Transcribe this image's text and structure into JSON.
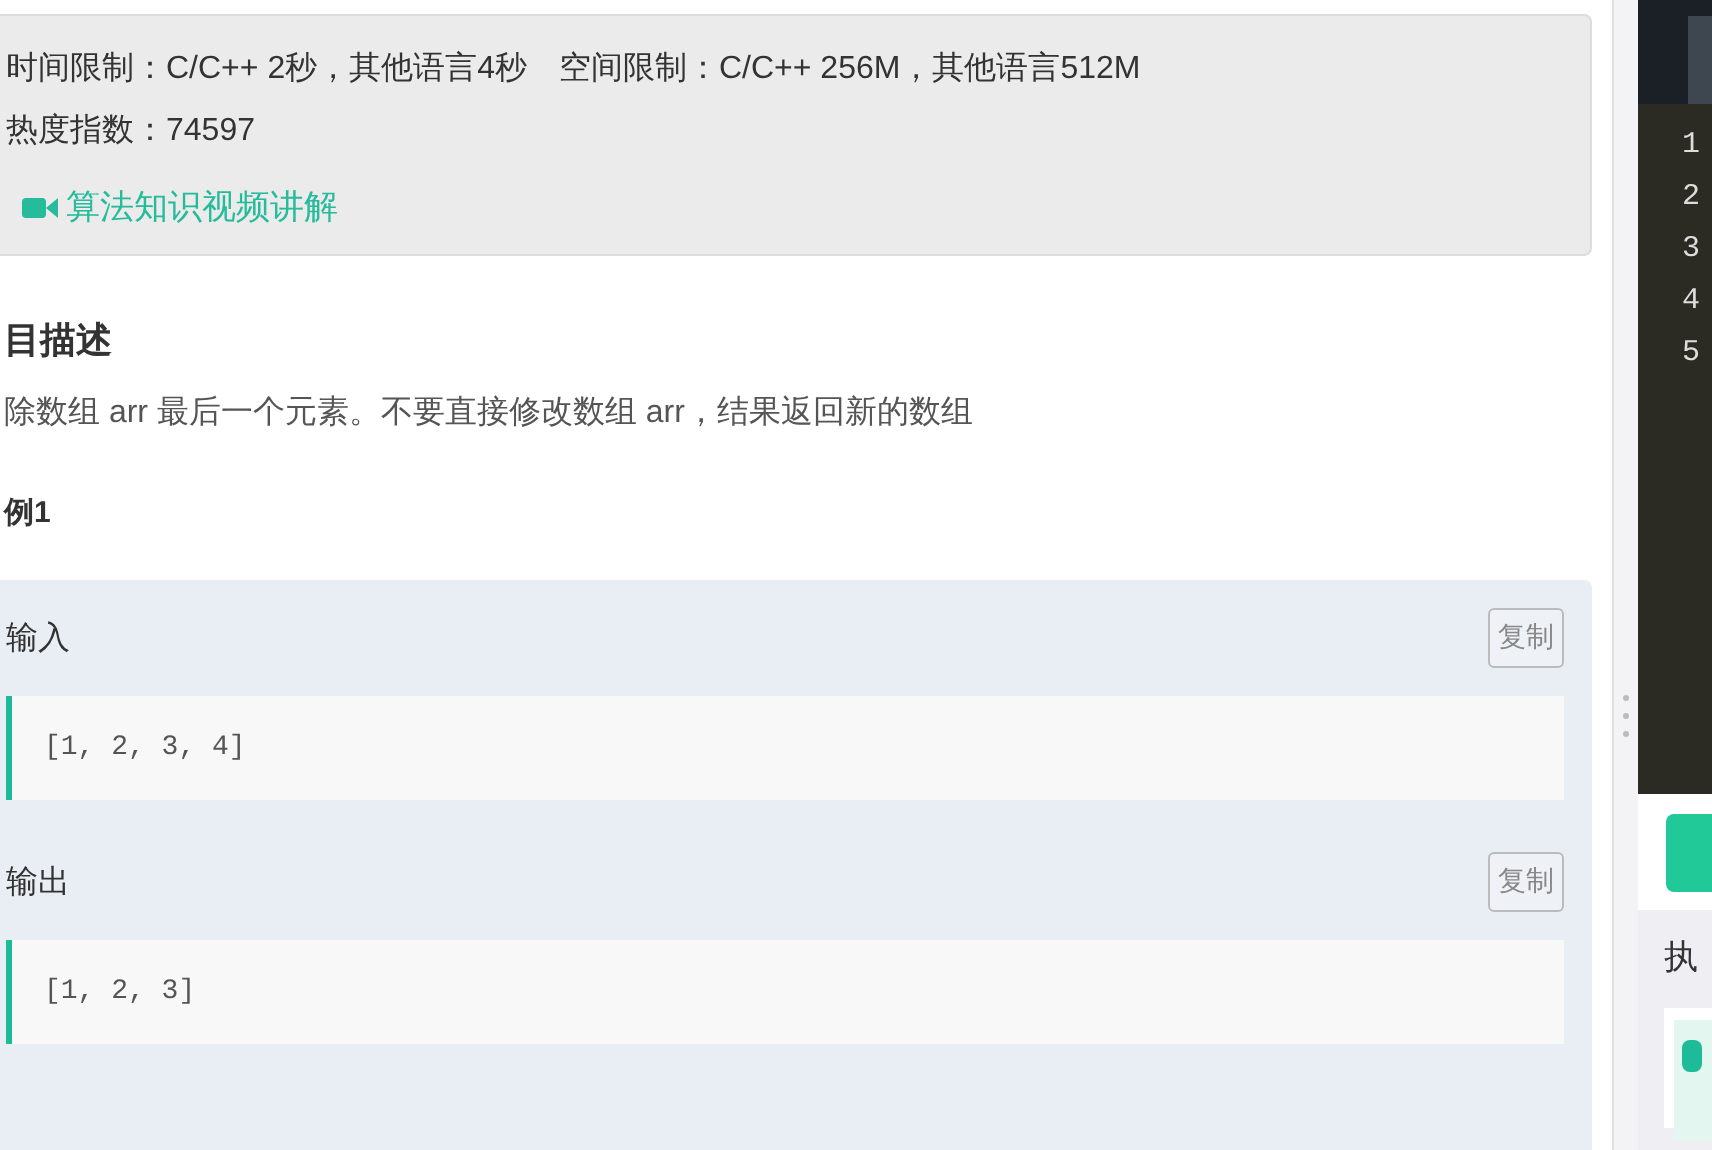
{
  "info": {
    "limits": "时间限制：C/C++ 2秒，其他语言4秒",
    "space": "空间限制：C/C++ 256M，其他语言512M",
    "heat": "热度指数：74597",
    "video_link": "算法知识视频讲解"
  },
  "description": {
    "heading": "目描述",
    "text": "除数组 arr 最后一个元素。不要直接修改数组 arr，结果返回新的数组"
  },
  "example": {
    "heading": "例1",
    "blocks": [
      {
        "label": "输入",
        "copy": "复制",
        "code": "[1, 2, 3, 4]"
      },
      {
        "label": "输出",
        "copy": "复制",
        "code": "[1, 2, 3]"
      }
    ]
  },
  "editor": {
    "line_numbers": [
      "1",
      "2",
      "3",
      "4",
      "5"
    ]
  },
  "result": {
    "heading": "执"
  }
}
